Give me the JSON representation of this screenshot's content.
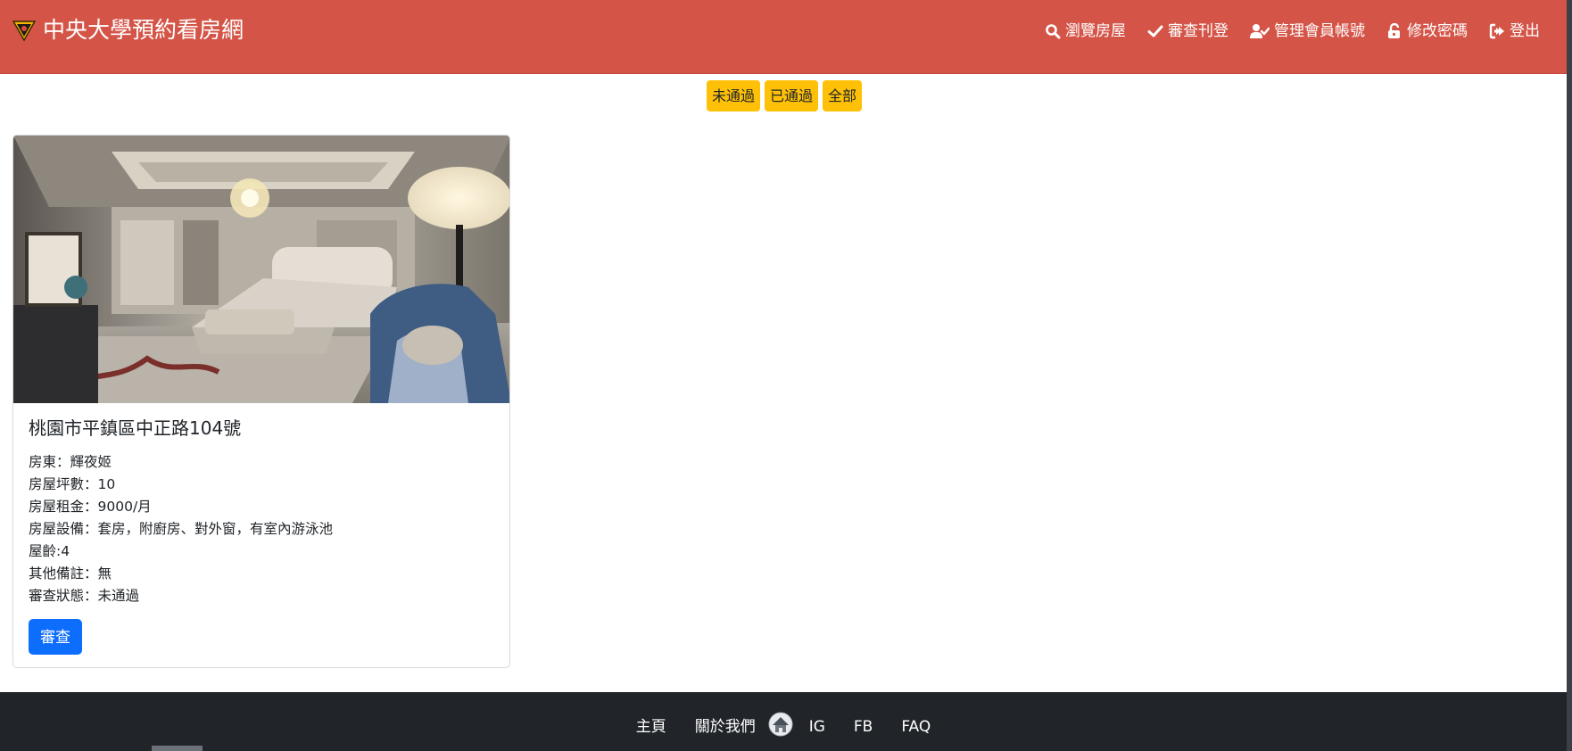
{
  "brand": {
    "title": "中央大學預約看房網"
  },
  "nav": [
    {
      "label": "瀏覽房屋",
      "icon": "search-icon"
    },
    {
      "label": "審查刊登",
      "icon": "check-icon"
    },
    {
      "label": "管理會員帳號",
      "icon": "user-check-icon"
    },
    {
      "label": "修改密碼",
      "icon": "unlock-icon"
    },
    {
      "label": "登出",
      "icon": "logout-icon"
    }
  ],
  "filters": [
    "未通過",
    "已通過",
    "全部"
  ],
  "listing": {
    "address": "桃園市平鎮區中正路104號",
    "landlord": "房東：輝夜姬",
    "area": "房屋坪數：10",
    "rent": "房屋租金：9000/月",
    "facilities": "房屋設備：套房，附廚房、對外窗，有室內游泳池",
    "age": "屋齡:4",
    "notes": "其他備註：無",
    "status": "審查狀態：未通過",
    "review_button": "審查"
  },
  "footer": {
    "home": "主頁",
    "about": "關於我們",
    "ig": "IG",
    "fb": "FB",
    "faq": "FAQ"
  },
  "colors": {
    "navbar": "#d45548",
    "filter_button": "#ffc107",
    "primary_button": "#0d6efd",
    "footer": "#212529"
  }
}
